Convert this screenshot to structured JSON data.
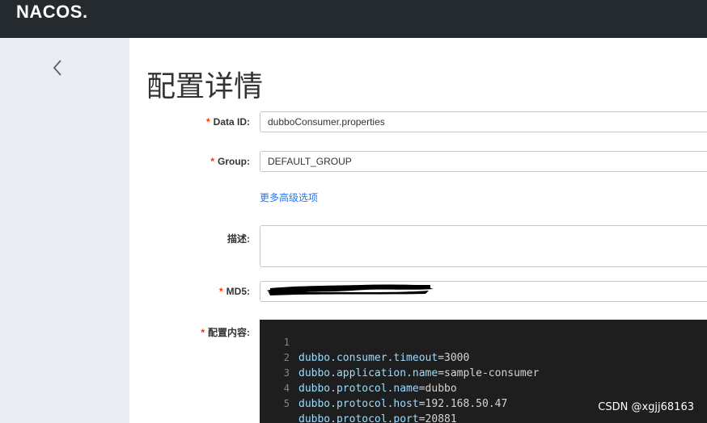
{
  "header": {
    "logo_text": "NACOS."
  },
  "sidebar": {
    "back_icon": "chevron-left-icon"
  },
  "page": {
    "title": "配置详情"
  },
  "form": {
    "data_id": {
      "label": "Data ID:",
      "required": "*",
      "value": "dubboConsumer.properties"
    },
    "group": {
      "label": "Group:",
      "required": "*",
      "value": "DEFAULT_GROUP"
    },
    "advanced_link": "更多高级选项",
    "description": {
      "label": "描述:",
      "value": ""
    },
    "md5": {
      "label": "MD5:",
      "required": "*"
    },
    "content": {
      "label": "配置内容:",
      "required": "*",
      "lines": [
        {
          "num": "1",
          "key": "dubbo.consumer.timeout",
          "eq": "=",
          "value": "3000"
        },
        {
          "num": "2",
          "key": "dubbo.application.name",
          "eq": "=",
          "value": "sample-consumer"
        },
        {
          "num": "3",
          "key": "dubbo.protocol.name",
          "eq": "=",
          "value": "dubbo"
        },
        {
          "num": "4",
          "key": "dubbo.protocol.host",
          "eq": "=",
          "value": "192.168.50.47"
        },
        {
          "num": "5",
          "key": "dubbo.protocol.port",
          "eq": "=",
          "value": "20881"
        }
      ]
    }
  },
  "watermark": "CSDN @xgjj68163",
  "colors": {
    "topbar": "#252a2f",
    "sidebar": "#eaedf1",
    "link": "#2077ff",
    "required": "#ff3000",
    "editor_bg": "#1e1e1e"
  }
}
